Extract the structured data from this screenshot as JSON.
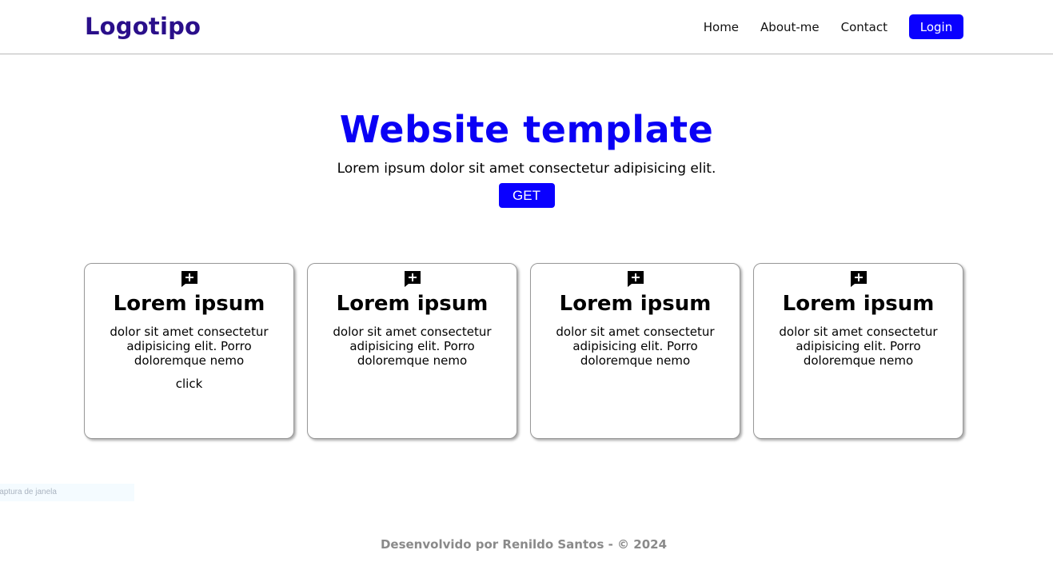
{
  "header": {
    "logo": "Logotipo",
    "nav": [
      "Home",
      "About-me",
      "Contact"
    ],
    "login_label": "Login"
  },
  "hero": {
    "title": "Website template",
    "subtitle": "Lorem ipsum dolor sit amet consectetur adipisicing elit.",
    "button_label": "GET"
  },
  "cards": [
    {
      "icon": "add-comment-icon",
      "title": "Lorem ipsum",
      "text": "dolor sit amet consectetur adipisicing elit. Porro doloremque nemo",
      "link": "click"
    },
    {
      "icon": "add-comment-icon",
      "title": "Lorem ipsum",
      "text": "dolor sit amet consectetur adipisicing elit. Porro doloremque nemo",
      "link": ""
    },
    {
      "icon": "add-comment-icon",
      "title": "Lorem ipsum",
      "text": "dolor sit amet consectetur adipisicing elit. Porro doloremque nemo",
      "link": ""
    },
    {
      "icon": "add-comment-icon",
      "title": "Lorem ipsum",
      "text": "dolor sit amet consectetur adipisicing elit. Porro doloremque nemo",
      "link": ""
    }
  ],
  "ghost_tooltip": "Captura de janela",
  "footer": "Desenvolvido por Renildo Santos - © 2024",
  "colors": {
    "accent": "#0a00ff",
    "logo": "#2a0f8a",
    "footer_text": "#8a8a8a"
  }
}
